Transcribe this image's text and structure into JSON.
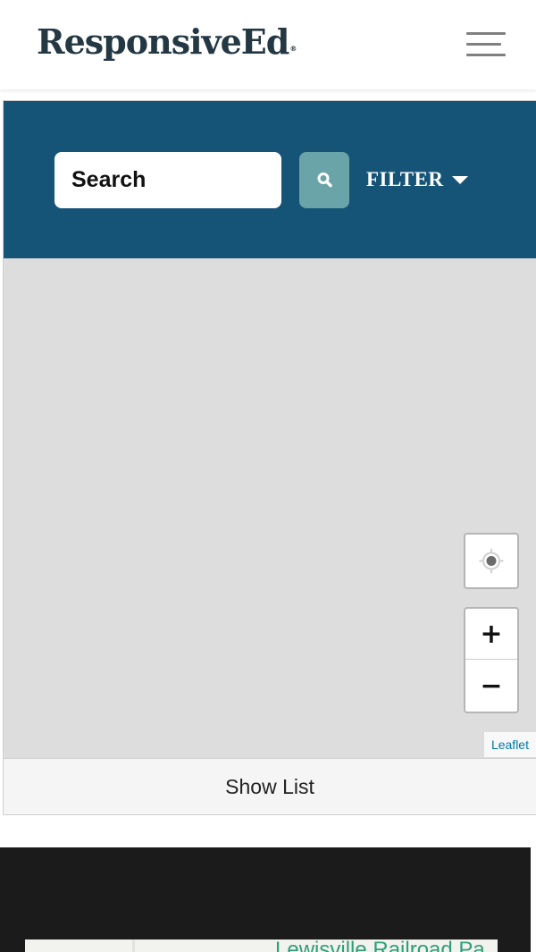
{
  "header": {
    "logo_text": "ResponsiveEd",
    "logo_mark": "®",
    "menu_icon": "hamburger-menu-icon"
  },
  "search": {
    "placeholder": "Search",
    "button_icon": "search-icon",
    "filter_label": "FILTER",
    "filter_icon": "caret-down-icon"
  },
  "map": {
    "locate_icon": "crosshair-locate-icon",
    "zoom_in_label": "+",
    "zoom_out_label": "−",
    "attribution": "Leaflet",
    "show_list_label": "Show List"
  },
  "preview": {
    "label": "Lewisville Railroad Pa"
  },
  "colors": {
    "brand_navy": "#243844",
    "search_band": "#165477",
    "search_button": "#6aa4a8",
    "map_background": "#dddddd",
    "link": "#0078a8",
    "dark_panel": "#1b1b1b",
    "park_label": "#2e9f7a"
  }
}
